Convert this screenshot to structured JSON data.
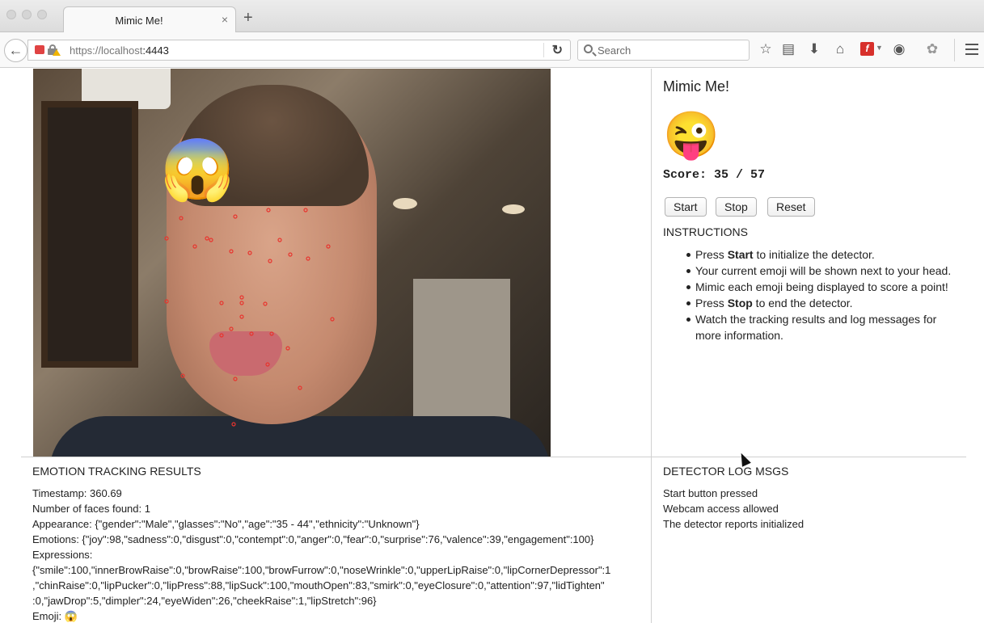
{
  "browser": {
    "tab_title": "Mimic Me!",
    "tab_close": "×",
    "new_tab": "+",
    "url_scheme": "https://localhost",
    "url_port": ":4443",
    "search_placeholder": "Search"
  },
  "app": {
    "title": "Mimic Me!",
    "target_emoji": "😜",
    "overlay_emoji": "😱",
    "score_text": "Score: 35 / 57",
    "buttons": {
      "start": "Start",
      "stop": "Stop",
      "reset": "Reset"
    },
    "instructions_heading": "INSTRUCTIONS",
    "instructions": [
      {
        "pre": "Press ",
        "bold": "Start",
        "post": " to initialize the detector."
      },
      {
        "pre": "Your current emoji will be shown next to your head.",
        "bold": "",
        "post": ""
      },
      {
        "pre": "Mimic each emoji being displayed to score a point!",
        "bold": "",
        "post": ""
      },
      {
        "pre": "Press ",
        "bold": "Stop",
        "post": " to end the detector."
      },
      {
        "pre": "Watch the tracking results and log messages for more information.",
        "bold": "",
        "post": ""
      }
    ]
  },
  "results": {
    "heading": "EMOTION TRACKING RESULTS",
    "timestamp": "Timestamp: 360.69",
    "faces": "Number of faces found: 1",
    "appearance": "Appearance: {\"gender\":\"Male\",\"glasses\":\"No\",\"age\":\"35 - 44\",\"ethnicity\":\"Unknown\"}",
    "emotions": "Emotions: {\"joy\":98,\"sadness\":0,\"disgust\":0,\"contempt\":0,\"anger\":0,\"fear\":0,\"surprise\":76,\"valence\":39,\"engagement\":100}",
    "expressions_label": "Expressions:",
    "expressions_1": "{\"smile\":100,\"innerBrowRaise\":0,\"browRaise\":100,\"browFurrow\":0,\"noseWrinkle\":0,\"upperLipRaise\":0,\"lipCornerDepressor\":1",
    "expressions_2": ",\"chinRaise\":0,\"lipPucker\":0,\"lipPress\":88,\"lipSuck\":100,\"mouthOpen\":83,\"smirk\":0,\"eyeClosure\":0,\"attention\":97,\"lidTighten\"",
    "expressions_3": ":0,\"jawDrop\":5,\"dimpler\":24,\"eyeWiden\":26,\"cheekRaise\":1,\"lipStretch\":96}",
    "emoji": "Emoji: 😱"
  },
  "log": {
    "heading": "DETECTOR LOG MSGS",
    "messages": [
      "Start button pressed",
      "Webcam access allowed",
      "The detector reports initialized"
    ]
  },
  "colors": {
    "landmark": "#e8342e",
    "accent_flash": "#d7302b"
  },
  "icons": [
    "back-arrow-icon",
    "camera-indicator-icon",
    "lock-warning-icon",
    "reload-icon",
    "search-icon",
    "bookmark-star-icon",
    "reading-list-icon",
    "download-icon",
    "home-icon",
    "flash-icon",
    "pocket-icon",
    "extension-icon",
    "hamburger-menu-icon"
  ]
}
